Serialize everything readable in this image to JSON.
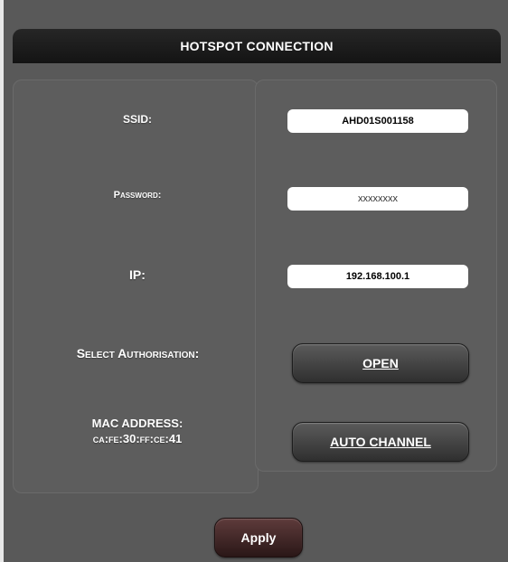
{
  "header": {
    "title": "HOTSPOT CONNECTION"
  },
  "fields": {
    "ssid": {
      "label": "SSID:",
      "value": "AHD01S001158"
    },
    "password": {
      "label": "Password:",
      "value": "xxxxxxxx"
    },
    "ip": {
      "label": "IP:",
      "value": "192.168.100.1"
    }
  },
  "authorisation": {
    "label": "Select Authorisation:",
    "button_label": "OPEN"
  },
  "mac": {
    "label": "MAC ADDRESS:",
    "value": "ca:fe:30:ff:ce:41",
    "button_label": "AUTO CHANNEL"
  },
  "actions": {
    "apply_label": "Apply"
  }
}
